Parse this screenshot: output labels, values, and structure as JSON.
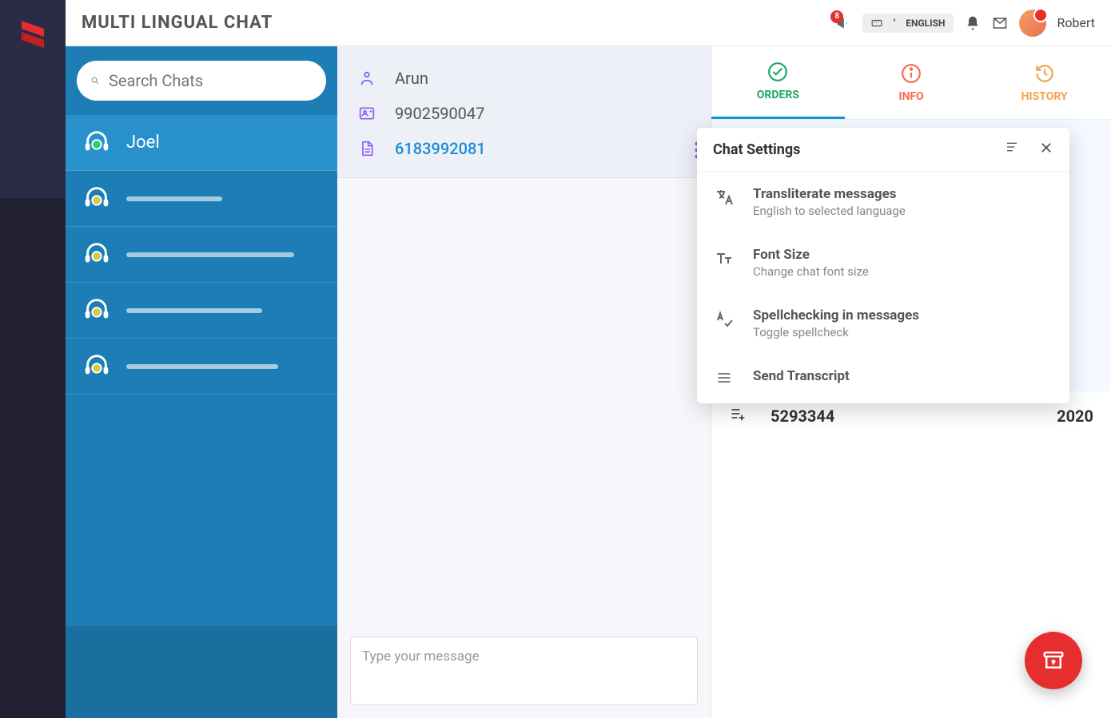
{
  "app_title": "MULTI LINGUAL CHAT",
  "header": {
    "badge_count": "8",
    "language_label": "ENGLISH",
    "username": "Robert"
  },
  "search": {
    "placeholder": "Search Chats"
  },
  "chats": [
    {
      "name": "Joel",
      "active": true,
      "status": "green"
    },
    {
      "name": "",
      "active": false,
      "status": "yellow",
      "ph_width": 120
    },
    {
      "name": "",
      "active": false,
      "status": "yellow",
      "ph_width": 210
    },
    {
      "name": "",
      "active": false,
      "status": "yellow",
      "ph_width": 170
    },
    {
      "name": "",
      "active": false,
      "status": "yellow",
      "ph_width": 190
    }
  ],
  "contact": {
    "name": "Arun",
    "phone": "9902590047",
    "order": "6183992081"
  },
  "compose": {
    "placeholder": "Type your message"
  },
  "tabs": {
    "orders": "ORDERS",
    "info": "INFO",
    "history": "HISTORY"
  },
  "order_row": {
    "id": "5293344",
    "year": "2020"
  },
  "dropdown": {
    "title": "Chat Settings",
    "items": [
      {
        "title": "Transliterate messages",
        "sub": "English to selected language",
        "icon": "translate"
      },
      {
        "title": "Font Size",
        "sub": "Change chat font size",
        "icon": "textsize"
      },
      {
        "title": "Spellchecking in messages",
        "sub": "Toggle spellcheck",
        "icon": "spellcheck"
      },
      {
        "title": "Send Transcript",
        "sub": "",
        "icon": "transcript"
      }
    ]
  },
  "colors": {
    "green_status": "#2ecc71",
    "yellow_status": "#d4c945"
  }
}
